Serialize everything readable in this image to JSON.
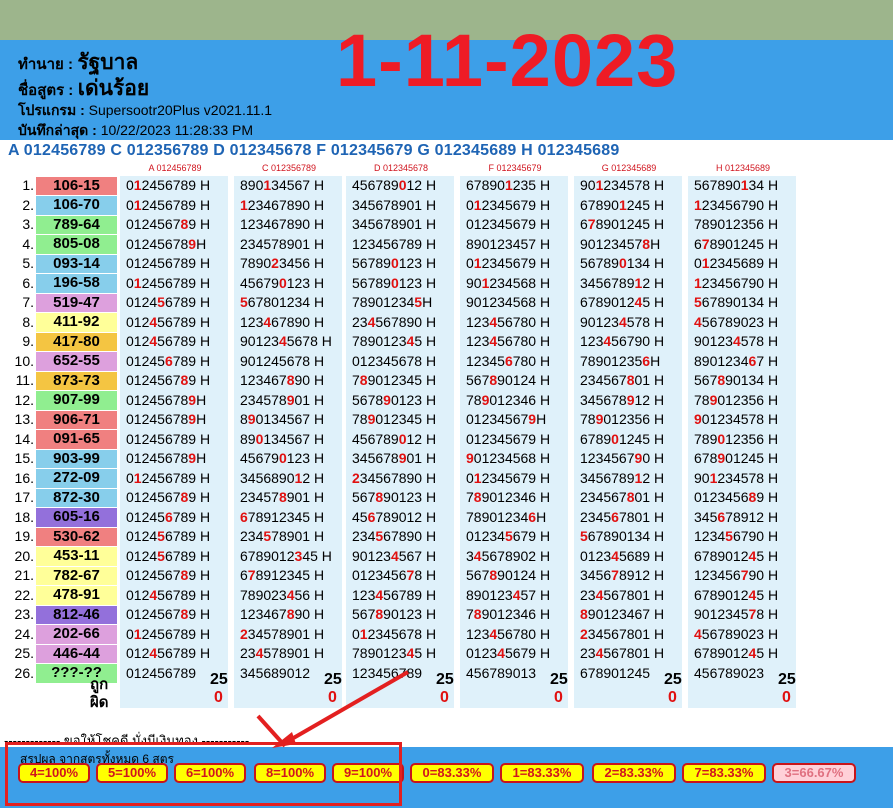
{
  "header": {
    "seller_label": "ทำนาย :",
    "seller_value": "รัฐบาล",
    "formula_label": "ชื่อสูตร :",
    "formula_value": "เด่นร้อย",
    "program_label": "โปรแกรม :",
    "program_value": "Supersootr20Plus v2021.11.1",
    "saved_label": "บันทึกล่าสุด :",
    "saved_value": "10/22/2023 11:28:33 PM",
    "date": "1-11-2023"
  },
  "formula_codes": "A 012456789 C 012356789 D 012345678 F 012345679 G 012345689 H 012345689",
  "columns": [
    {
      "code": "A 012456789"
    },
    {
      "code": "C 012356789"
    },
    {
      "code": "D 012345678"
    },
    {
      "code": "F 012345679"
    },
    {
      "code": "G 012345689"
    },
    {
      "code": "H 012345689"
    }
  ],
  "rows": [
    {
      "n": "1.",
      "r": "106-15",
      "c": "#f08080",
      "cells": [
        [
          "0",
          "1",
          "2456789 H"
        ],
        [
          "890",
          "1",
          "34567 H"
        ],
        [
          "456789",
          "0",
          "12 H"
        ],
        [
          "67890",
          "1",
          "235 H"
        ],
        [
          "90",
          "1",
          "234578 H"
        ],
        [
          "567890",
          "1",
          "34 H"
        ]
      ]
    },
    {
      "n": "2.",
      "r": "106-70",
      "c": "#87ceeb",
      "cells": [
        [
          "0",
          "1",
          "2456789 H"
        ],
        [
          "",
          "1",
          "23467890 H"
        ],
        [
          "345678901 H",
          "",
          ""
        ],
        [
          "0",
          "1",
          "2345679 H"
        ],
        [
          "67890",
          "1",
          "245 H"
        ],
        [
          "",
          "1",
          "23456790 H"
        ]
      ]
    },
    {
      "n": "3.",
      "r": "789-64",
      "c": "#90ee90",
      "cells": [
        [
          "0124567",
          "8",
          "9 H"
        ],
        [
          "123467890 H",
          "",
          ""
        ],
        [
          "345678901 H",
          "",
          ""
        ],
        [
          "012345679 H",
          "",
          ""
        ],
        [
          "6",
          "7",
          "8901245 H"
        ],
        [
          "789012356 H",
          "",
          ""
        ]
      ]
    },
    {
      "n": "4.",
      "r": "805-08",
      "c": "#90ee90",
      "cells": [
        [
          "01245678",
          "9",
          "H"
        ],
        [
          "234578901 H",
          "",
          ""
        ],
        [
          "123456789 H",
          "",
          ""
        ],
        [
          "890123457 H",
          "",
          ""
        ],
        [
          "90123457",
          "8",
          "H"
        ],
        [
          "6",
          "7",
          "8901245 H"
        ]
      ]
    },
    {
      "n": "5.",
      "r": "093-14",
      "c": "#87ceeb",
      "cells": [
        [
          "0",
          "",
          "12456789 H"
        ],
        [
          "7890",
          "2",
          "3456 H"
        ],
        [
          "56789",
          "0",
          "123 H"
        ],
        [
          "0",
          "1",
          "2345679 H"
        ],
        [
          "56789",
          "0",
          "134 H"
        ],
        [
          "0",
          "1",
          "2345689 H"
        ]
      ]
    },
    {
      "n": "6.",
      "r": "196-58",
      "c": "#87ceeb",
      "cells": [
        [
          "0",
          "1",
          "2456789 H"
        ],
        [
          "45679",
          "0",
          "123 H"
        ],
        [
          "56789",
          "0",
          "123 H"
        ],
        [
          "90",
          "1",
          "234568 H"
        ],
        [
          "3456789",
          "1",
          "2 H"
        ],
        [
          "",
          "1",
          "23456790 H"
        ]
      ]
    },
    {
      "n": "7.",
      "r": "519-47",
      "c": "#dda0dd",
      "cells": [
        [
          "0124",
          "5",
          "6789 H"
        ],
        [
          "",
          "5",
          "67801234 H"
        ],
        [
          "78901234",
          "5",
          "H"
        ],
        [
          "901234568 H",
          "",
          ""
        ],
        [
          "6789012",
          "4",
          "5 H"
        ],
        [
          "",
          "5",
          "67890134 H"
        ]
      ]
    },
    {
      "n": "8.",
      "r": "411-92",
      "c": "#ffff99",
      "cells": [
        [
          "012",
          "4",
          "56789 H"
        ],
        [
          "123",
          "4",
          "67890 H"
        ],
        [
          "23",
          "4",
          "567890 H"
        ],
        [
          "123",
          "4",
          "56780 H"
        ],
        [
          "90123",
          "4",
          "578 H"
        ],
        [
          "",
          "4",
          "56789023 H"
        ]
      ]
    },
    {
      "n": "9.",
      "r": "417-80",
      "c": "#f4c542",
      "cells": [
        [
          "012",
          "4",
          "56789 H"
        ],
        [
          "90123",
          "4",
          "5678 H"
        ],
        [
          "7890123",
          "4",
          "5 H"
        ],
        [
          "123",
          "4",
          "56780 H"
        ],
        [
          "123",
          "4",
          "56790 H"
        ],
        [
          "90123",
          "4",
          "578 H"
        ]
      ]
    },
    {
      "n": "10.",
      "r": "652-55",
      "c": "#dda0dd",
      "cells": [
        [
          "01245",
          "6",
          "789 H"
        ],
        [
          "901245678 H",
          "",
          ""
        ],
        [
          "012345678 H",
          "",
          ""
        ],
        [
          "12345",
          "6",
          "780 H"
        ],
        [
          "78901235",
          "6",
          "H"
        ],
        [
          "8901234",
          "6",
          "7 H"
        ]
      ]
    },
    {
      "n": "11.",
      "r": "873-73",
      "c": "#f4c542",
      "cells": [
        [
          "0124567",
          "8",
          "9 H"
        ],
        [
          "123467",
          "8",
          "90 H"
        ],
        [
          "7",
          "8",
          "9012345 H"
        ],
        [
          "567",
          "8",
          "90124 H"
        ],
        [
          "234567",
          "8",
          "01 H"
        ],
        [
          "567",
          "8",
          "90134 H"
        ]
      ]
    },
    {
      "n": "12.",
      "r": "907-99",
      "c": "#90ee90",
      "cells": [
        [
          "01245678",
          "9",
          "H"
        ],
        [
          "234578",
          "9",
          "01 H"
        ],
        [
          "5678",
          "9",
          "0123 H"
        ],
        [
          "78",
          "9",
          "012346 H"
        ],
        [
          "345678",
          "9",
          "12 H"
        ],
        [
          "78",
          "9",
          "012356 H"
        ]
      ]
    },
    {
      "n": "13.",
      "r": "906-71",
      "c": "#f08080",
      "cells": [
        [
          "01245678",
          "9",
          "H"
        ],
        [
          "8",
          "9",
          "0134567 H"
        ],
        [
          "78",
          "9",
          "012345 H"
        ],
        [
          "01234567",
          "9",
          "H"
        ],
        [
          "78",
          "9",
          "012356 H"
        ],
        [
          "",
          "9",
          "01234578 H"
        ]
      ]
    },
    {
      "n": "14.",
      "r": "091-65",
      "c": "#f08080",
      "cells": [
        [
          "0",
          "",
          "12456789 H"
        ],
        [
          "89",
          "0",
          "134567 H"
        ],
        [
          "456789",
          "0",
          "12 H"
        ],
        [
          "0",
          "",
          "12345679 H"
        ],
        [
          "6789",
          "0",
          "1245 H"
        ],
        [
          "789",
          "0",
          "12356 H"
        ]
      ]
    },
    {
      "n": "15.",
      "r": "903-99",
      "c": "#87ceeb",
      "cells": [
        [
          "01245678",
          "9",
          "H"
        ],
        [
          "45679",
          "0",
          "123 H"
        ],
        [
          "345678",
          "9",
          "01 H"
        ],
        [
          "",
          "9",
          "01234568 H"
        ],
        [
          "1234567",
          "9",
          "0 H"
        ],
        [
          "678",
          "9",
          "01245 H"
        ]
      ]
    },
    {
      "n": "16.",
      "r": "272-09",
      "c": "#87ceeb",
      "cells": [
        [
          "0",
          "1",
          "2456789 H"
        ],
        [
          "3456890",
          "1",
          "2 H"
        ],
        [
          "",
          "2",
          "34567890 H"
        ],
        [
          "0",
          "1",
          "2345679 H"
        ],
        [
          "3456789",
          "1",
          "2 H"
        ],
        [
          "90",
          "1",
          "234578 H"
        ]
      ]
    },
    {
      "n": "17.",
      "r": "872-30",
      "c": "#87ceeb",
      "cells": [
        [
          "0124567",
          "8",
          "9 H"
        ],
        [
          "23457",
          "8",
          "901 H"
        ],
        [
          "567",
          "8",
          "90123 H"
        ],
        [
          "7",
          "8",
          "9012346 H"
        ],
        [
          "234567",
          "8",
          "01 H"
        ],
        [
          "0123456",
          "8",
          "9 H"
        ]
      ]
    },
    {
      "n": "18.",
      "r": "605-16",
      "c": "#9370db",
      "cells": [
        [
          "01245",
          "6",
          "789 H"
        ],
        [
          "",
          "6",
          "78912345 H"
        ],
        [
          "45",
          "6",
          "789012 H"
        ],
        [
          "78901234",
          "6",
          "H"
        ],
        [
          "2345",
          "6",
          "7801 H"
        ],
        [
          "345",
          "6",
          "78912 H"
        ]
      ]
    },
    {
      "n": "19.",
      "r": "530-62",
      "c": "#f08080",
      "cells": [
        [
          "0124",
          "5",
          "6789 H"
        ],
        [
          "234",
          "5",
          "78901 H"
        ],
        [
          "234",
          "5",
          "67890 H"
        ],
        [
          "01234",
          "5",
          "679 H"
        ],
        [
          "",
          "5",
          "67890134 H"
        ],
        [
          "1234",
          "5",
          "6790 H"
        ]
      ]
    },
    {
      "n": "20.",
      "r": "453-11",
      "c": "#ffff99",
      "cells": [
        [
          "0124",
          "5",
          "6789 H"
        ],
        [
          "6789012",
          "3",
          "45 H"
        ],
        [
          "90123",
          "4",
          "567 H"
        ],
        [
          "3",
          "4",
          "5678902 H"
        ],
        [
          "0123",
          "4",
          "5689 H"
        ],
        [
          "6789012",
          "4",
          "5 H"
        ]
      ]
    },
    {
      "n": "21.",
      "r": "782-67",
      "c": "#ffff99",
      "cells": [
        [
          "0124567",
          "8",
          "9 H"
        ],
        [
          "6",
          "7",
          "8912345 H"
        ],
        [
          "0123456",
          "7",
          "8 H"
        ],
        [
          "567",
          "8",
          "90124 H"
        ],
        [
          "3456",
          "7",
          "8912 H"
        ],
        [
          "123456",
          "7",
          "90 H"
        ]
      ]
    },
    {
      "n": "22.",
      "r": "478-91",
      "c": "#ffff99",
      "cells": [
        [
          "012",
          "4",
          "56789 H"
        ],
        [
          "789023",
          "4",
          "56 H"
        ],
        [
          "123",
          "4",
          "56789 H"
        ],
        [
          "890123",
          "4",
          "57 H"
        ],
        [
          "23",
          "4",
          "567801 H"
        ],
        [
          "6789012",
          "4",
          "5 H"
        ]
      ]
    },
    {
      "n": "23.",
      "r": "812-46",
      "c": "#9370db",
      "cells": [
        [
          "0124567",
          "8",
          "9 H"
        ],
        [
          "123467",
          "8",
          "90 H"
        ],
        [
          "567",
          "8",
          "90123 H"
        ],
        [
          "7",
          "8",
          "9012346 H"
        ],
        [
          "",
          "8",
          "90123467 H"
        ],
        [
          "9012345",
          "7",
          "8 H"
        ]
      ]
    },
    {
      "n": "24.",
      "r": "202-66",
      "c": "#dda0dd",
      "cells": [
        [
          "0",
          "1",
          "2456789 H"
        ],
        [
          "",
          "2",
          "34578901 H"
        ],
        [
          "0",
          "1",
          "2345678 H"
        ],
        [
          "123",
          "4",
          "56780 H"
        ],
        [
          "",
          "2",
          "34567801 H"
        ],
        [
          "",
          "4",
          "56789023 H"
        ]
      ]
    },
    {
      "n": "25.",
      "r": "446-44",
      "c": "#dda0dd",
      "cells": [
        [
          "012",
          "4",
          "56789 H"
        ],
        [
          "23",
          "4",
          "578901 H"
        ],
        [
          "7890123",
          "4",
          "5 H"
        ],
        [
          "0123",
          "4",
          "5679 H"
        ],
        [
          "23",
          "4",
          "567801 H"
        ],
        [
          "6789012",
          "4",
          "5 H"
        ]
      ]
    },
    {
      "n": "26.",
      "r": "???-??",
      "c": "#90ee90",
      "cells": [
        [
          "012456789",
          "",
          ""
        ],
        [
          "345689012",
          "",
          ""
        ],
        [
          "123456789",
          "",
          ""
        ],
        [
          "456789013",
          "",
          ""
        ],
        [
          "678901245",
          "",
          ""
        ],
        [
          "456789023",
          "",
          ""
        ]
      ]
    }
  ],
  "totals": {
    "hit_label": "ถูก",
    "miss_label": "ผิด",
    "hit": "25",
    "miss": "0"
  },
  "bottom_note": "------------- ขอให้โชคดี มั่งมีเงินทอง -----------",
  "summary": {
    "title": "สรุปผล จากสูตรทั้งหมด 6 สูตร",
    "pills": [
      "4=100%",
      "5=100%",
      "6=100%",
      "8=100%",
      "9=100%",
      "0=83.33%",
      "1=83.33%",
      "2=83.33%",
      "7=83.33%",
      "3=66.67%"
    ]
  },
  "colors": {
    "header_bg": "#3d9fe8",
    "top_bg": "#9db58c",
    "date_red": "#ee1c25",
    "code_blue": "#1e64b4",
    "pill_bg": "#ffff00",
    "pill_last_bg": "#ffd0d8"
  }
}
